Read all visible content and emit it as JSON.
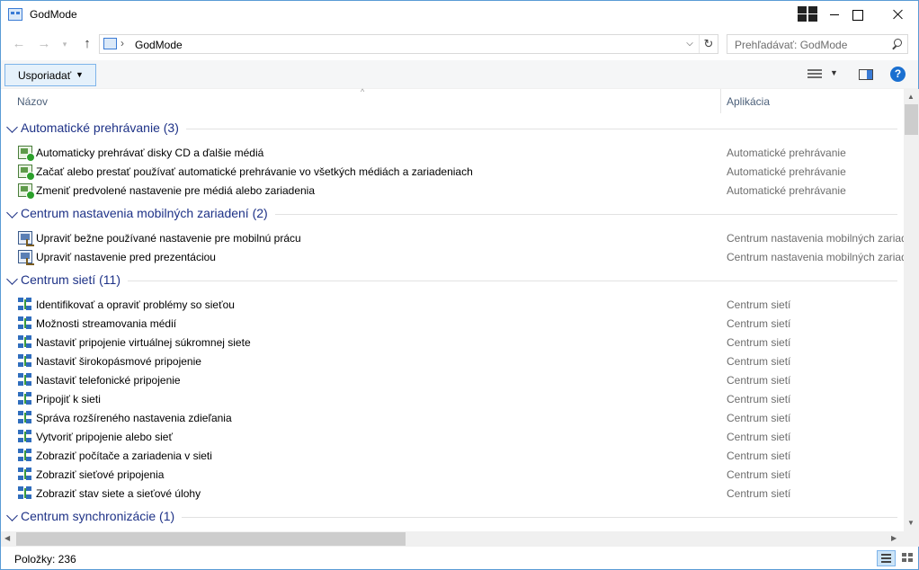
{
  "window": {
    "title": "GodMode"
  },
  "nav": {
    "back": "←",
    "forward": "→",
    "recent": "▾",
    "up": "↑",
    "address_separator": "›",
    "address": "GodMode",
    "address_dropdown": "⌵",
    "refresh": "↻",
    "search_placeholder": "Prehľadávať: GodMode"
  },
  "commandbar": {
    "organize_label": "Usporiadať",
    "organize_arrow": "▼",
    "view_dropdown": "▼",
    "help": "?"
  },
  "columns": {
    "sort_caret": "^",
    "name": "Názov",
    "app": "Aplikácia"
  },
  "groups": [
    {
      "label": "Automatické prehrávanie (3)",
      "icon": "autoplay-icon",
      "items": [
        {
          "label": "Automaticky prehrávať disky CD a ďalšie médiá",
          "app": "Automatické prehrávanie"
        },
        {
          "label": "Začať alebo prestať používať automatické prehrávanie vo všetkých médiách a zariadeniach",
          "app": "Automatické prehrávanie"
        },
        {
          "label": "Zmeniť predvolené nastavenie pre médiá alebo zariadenia",
          "app": "Automatické prehrávanie"
        }
      ]
    },
    {
      "label": "Centrum nastavenia mobilných zariadení (2)",
      "icon": "mobility-center-icon",
      "items": [
        {
          "label": "Upraviť bežne používané nastavenie pre mobilnú prácu",
          "app": "Centrum nastavenia mobilných zariadení"
        },
        {
          "label": "Upraviť nastavenie pred prezentáciou",
          "app": "Centrum nastavenia mobilných zariadení"
        }
      ]
    },
    {
      "label": "Centrum sietí (11)",
      "icon": "network-icon",
      "items": [
        {
          "label": "Identifikovať a opraviť problémy so sieťou",
          "app": "Centrum sietí"
        },
        {
          "label": "Možnosti streamovania médií",
          "app": "Centrum sietí"
        },
        {
          "label": "Nastaviť pripojenie virtuálnej súkromnej siete",
          "app": "Centrum sietí"
        },
        {
          "label": "Nastaviť širokopásmové pripojenie",
          "app": "Centrum sietí"
        },
        {
          "label": "Nastaviť telefonické pripojenie",
          "app": "Centrum sietí"
        },
        {
          "label": "Pripojiť k sieti",
          "app": "Centrum sietí"
        },
        {
          "label": "Správa rozšíreného nastavenia zdieľania",
          "app": "Centrum sietí"
        },
        {
          "label": "Vytvoriť pripojenie alebo sieť",
          "app": "Centrum sietí"
        },
        {
          "label": "Zobraziť počítače a zariadenia v sieti",
          "app": "Centrum sietí"
        },
        {
          "label": "Zobraziť sieťové pripojenia",
          "app": "Centrum sietí"
        },
        {
          "label": "Zobraziť stav siete a sieťové úlohy",
          "app": "Centrum sietí"
        }
      ]
    },
    {
      "label": "Centrum synchronizácie (1)",
      "icon": "sync-center-icon",
      "items": []
    }
  ],
  "scroll": {
    "up": "▲",
    "down": "▼",
    "left": "◀",
    "right": "▶"
  },
  "status": {
    "items_count": "Položky: 236"
  }
}
